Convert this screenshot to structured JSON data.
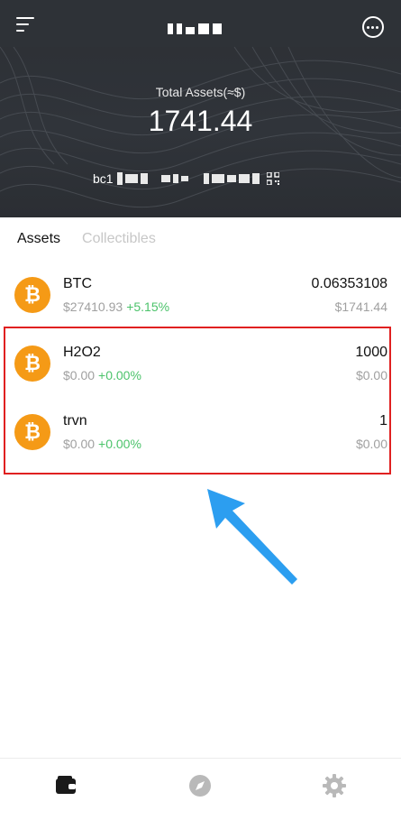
{
  "header": {
    "total_label": "Total Assets(≈$)",
    "total_value": "1741.44",
    "address_prefix": "bc1"
  },
  "tabs": [
    {
      "label": "Assets",
      "active": true
    },
    {
      "label": "Collectibles",
      "active": false
    }
  ],
  "assets": [
    {
      "name": "BTC",
      "price": "$27410.93",
      "change": "+5.15%",
      "amount": "0.06353108",
      "value": "$1741.44",
      "icon": "bitcoin-icon"
    },
    {
      "name": "H2O2",
      "price": "$0.00",
      "change": "+0.00%",
      "amount": "1000",
      "value": "$0.00",
      "icon": "bitcoin-icon"
    },
    {
      "name": "trvn",
      "price": "$0.00",
      "change": "+0.00%",
      "amount": "1",
      "value": "$0.00",
      "icon": "bitcoin-icon"
    }
  ],
  "nav": [
    {
      "icon": "wallet-icon",
      "active": true
    },
    {
      "icon": "compass-icon",
      "active": false
    },
    {
      "icon": "gear-icon",
      "active": false
    }
  ],
  "colors": {
    "header_bg": "#2e3237",
    "accent_orange": "#f59a16",
    "positive_green": "#4cc36b",
    "highlight_red": "#e02020",
    "arrow_blue": "#2c9ef0"
  }
}
